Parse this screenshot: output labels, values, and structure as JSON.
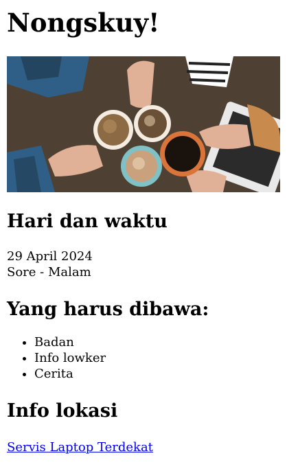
{
  "page": {
    "title": "Nongskuy!"
  },
  "hero_image": {
    "name": "coffee-cups-photo",
    "colors": {
      "table": "#5a4a3c",
      "table_dark": "#3b2f26",
      "shirt_blue": "#2f5f86",
      "shirt_dark": "#1f3a4f",
      "cup_rim": "#f4ece0",
      "coffee_dark": "#1a120c",
      "cup_orange": "#d9743a",
      "cup_teal": "#7fc1c4",
      "latte": "#c9a27d",
      "skin": "#e0b197",
      "sweater": "#c98a4d",
      "tablet": "#e9e9e9"
    }
  },
  "schedule": {
    "heading": "Hari dan waktu",
    "date": "29 April 2024",
    "time": "Sore - Malam"
  },
  "bring": {
    "heading": "Yang harus dibawa:",
    "items": [
      "Badan",
      "Info lowker",
      "Cerita"
    ]
  },
  "location": {
    "heading": "Info lokasi",
    "link_text": "Servis Laptop Terdekat"
  }
}
